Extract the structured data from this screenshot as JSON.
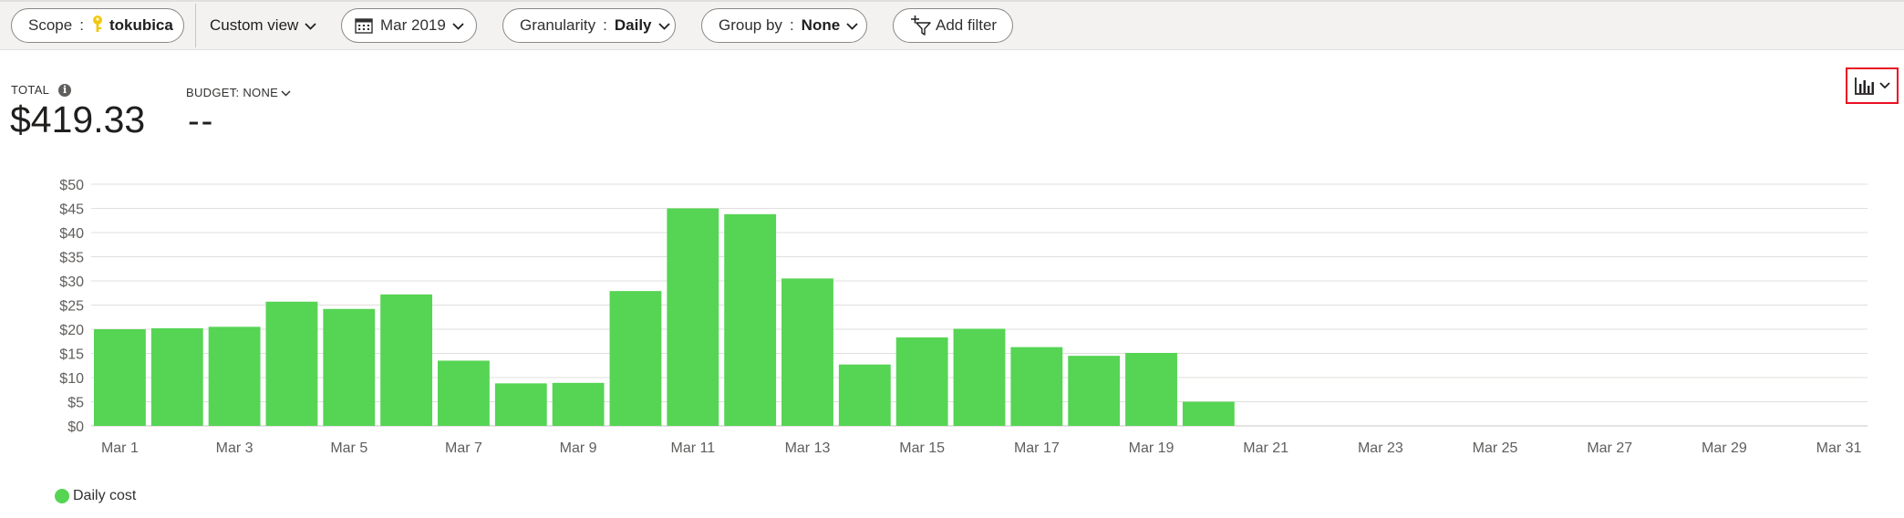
{
  "toolbar": {
    "scope": {
      "label": "Scope",
      "separator": ":",
      "value": "tokubica",
      "icon": "key-icon"
    },
    "view": {
      "label": "Custom view"
    },
    "date": {
      "label": "Mar 2019",
      "icon": "calendar-icon"
    },
    "granularity": {
      "label": "Granularity",
      "separator": ":",
      "value": "Daily"
    },
    "group_by": {
      "label": "Group by",
      "separator": ":",
      "value": "None"
    },
    "add_filter": {
      "label": "Add filter",
      "icon": "add-filter-icon"
    }
  },
  "summary": {
    "total_label": "TOTAL",
    "total_value": "$419.33",
    "budget_label": "BUDGET: NONE",
    "budget_value": "--"
  },
  "chart_type_button": {
    "icon": "bar-chart-icon"
  },
  "colors": {
    "accent": "#56d454",
    "highlight_border": "#e81123",
    "grid": "#e1dfdd"
  },
  "chart_data": {
    "type": "bar",
    "categories": [
      "Mar 1",
      "Mar 2",
      "Mar 3",
      "Mar 4",
      "Mar 5",
      "Mar 6",
      "Mar 7",
      "Mar 8",
      "Mar 9",
      "Mar 10",
      "Mar 11",
      "Mar 12",
      "Mar 13",
      "Mar 14",
      "Mar 15",
      "Mar 16",
      "Mar 17",
      "Mar 18",
      "Mar 19",
      "Mar 20",
      "Mar 21",
      "Mar 22",
      "Mar 23",
      "Mar 24",
      "Mar 25",
      "Mar 26",
      "Mar 27",
      "Mar 28",
      "Mar 29",
      "Mar 30",
      "Mar 31"
    ],
    "x_tick_labels": [
      "Mar 1",
      "Mar 3",
      "Mar 5",
      "Mar 7",
      "Mar 9",
      "Mar 11",
      "Mar 13",
      "Mar 15",
      "Mar 17",
      "Mar 19",
      "Mar 21",
      "Mar 23",
      "Mar 25",
      "Mar 27",
      "Mar 29",
      "Mar 31"
    ],
    "series": [
      {
        "name": "Daily cost",
        "color": "#56d454",
        "values": [
          20.0,
          20.2,
          20.5,
          25.7,
          24.2,
          27.2,
          13.5,
          8.8,
          8.9,
          27.9,
          45.0,
          43.8,
          30.5,
          12.7,
          18.3,
          20.1,
          16.3,
          14.5,
          15.1,
          5.0,
          0,
          0,
          0,
          0,
          0,
          0,
          0,
          0,
          0,
          0,
          0
        ]
      }
    ],
    "y_ticks": [
      "$0",
      "$5",
      "$10",
      "$15",
      "$20",
      "$25",
      "$30",
      "$35",
      "$40",
      "$45",
      "$50"
    ],
    "ylim": [
      0,
      50
    ],
    "grid": true,
    "legend": "bottom-left"
  }
}
